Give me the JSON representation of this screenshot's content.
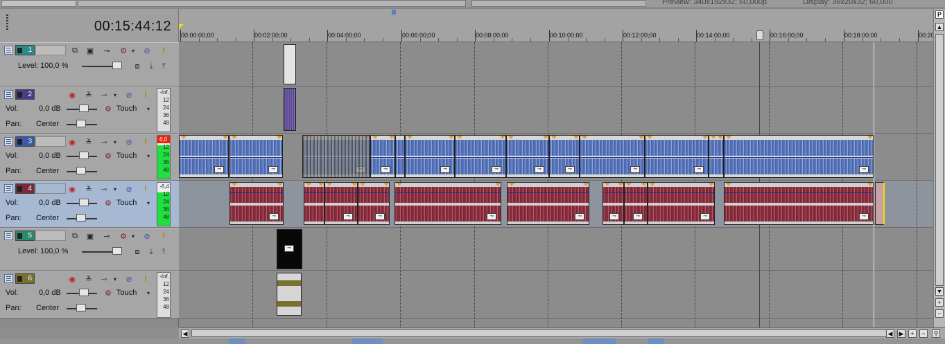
{
  "top_bar": {
    "preview_text": "Preview:  340x192x32; 60,000p",
    "display_text": "Display:  36x20x32; 60,000"
  },
  "header": {
    "timecode": "00:15:44:12"
  },
  "ruler": {
    "labels": [
      "00:00:00;00",
      "00:02:00;00",
      "00:04:00;00",
      "00:06:00;00",
      "00:08:00;00",
      "00:10:00;00",
      "00:12:00;00",
      "00:14:00;00",
      "00:16:00;00",
      "00:18:00;00",
      "00:20"
    ]
  },
  "tracks": [
    {
      "number": "1",
      "kind": "video",
      "color": "#2a8a8a",
      "level_label": "Level:",
      "level_value": "100,0 %"
    },
    {
      "number": "2",
      "kind": "audio",
      "color": "#4a3a8a",
      "vol_label": "Vol:",
      "vol_value": "0,0 dB",
      "pan_label": "Pan:",
      "pan_value": "Center",
      "mode": "Touch",
      "meter_top": "-Inf.",
      "meter_ticks": [
        "12",
        "24",
        "36",
        "48"
      ]
    },
    {
      "number": "3",
      "kind": "audio",
      "color": "#3a5aa8",
      "vol_label": "Vol:",
      "vol_value": "0,0 dB",
      "pan_label": "Pan:",
      "pan_value": "Center",
      "mode": "Touch",
      "meter_top": "6,0",
      "meter_ticks": [
        "12",
        "24",
        "36",
        "48"
      ]
    },
    {
      "number": "4",
      "kind": "audio",
      "color": "#7a2a3a",
      "vol_label": "Vol:",
      "vol_value": "0,0 dB",
      "pan_label": "Pan:",
      "pan_value": "Center",
      "mode": "Touch",
      "meter_top": "-6,4",
      "meter_ticks": [
        "12",
        "24",
        "36",
        "48"
      ]
    },
    {
      "number": "5",
      "kind": "video",
      "color": "#2a8a6a",
      "level_label": "Level:",
      "level_value": "100,0 %"
    },
    {
      "number": "6",
      "kind": "audio",
      "color": "#7a7030",
      "vol_label": "Vol:",
      "vol_value": "0,0 dB",
      "pan_label": "Pan:",
      "pan_value": "Center",
      "mode": "Touch",
      "meter_top": "-Inf.",
      "meter_ticks": [
        "12",
        "24",
        "36",
        "48"
      ]
    }
  ],
  "icons": {
    "collapse": "collapse-track-icon",
    "composite": "composite-mode-icon",
    "motion": "track-motion-icon",
    "fx": "track-fx-icon",
    "mute": "mute-icon",
    "solo": "solo-icon",
    "arm": "record-arm-icon",
    "automation": "automation-icon",
    "fx_chain": "fx-chain-icon"
  },
  "colors": {
    "audio_blue": "#5a76b8",
    "audio_red": "#8a3040",
    "meter_green": "#20e040",
    "meter_red": "#e21111",
    "selected_track": "#a6b8d2"
  }
}
